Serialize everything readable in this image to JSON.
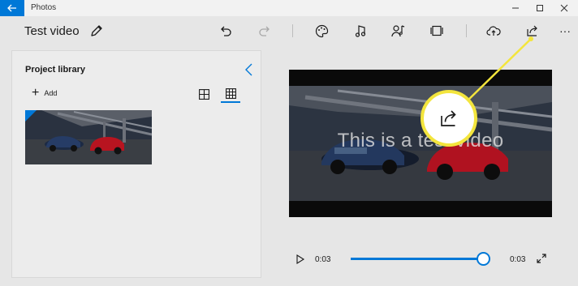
{
  "window": {
    "app_title": "Photos",
    "back_icon": "arrow-left-icon",
    "minimize_icon": "minimize-icon",
    "maximize_icon": "maximize-icon",
    "close_icon": "close-icon"
  },
  "toolbar": {
    "title": "Test video",
    "edit_icon": "pencil-icon",
    "undo_icon": "undo-icon",
    "redo_icon": "redo-icon",
    "themes_icon": "palette-icon",
    "music_icon": "music-note-icon",
    "narration_icon": "custom-audio-icon",
    "aspect_icon": "aspect-ratio-icon",
    "upload_icon": "cloud-upload-icon",
    "share_icon": "share-icon",
    "more_icon": "more-icon",
    "more_label": "···"
  },
  "library": {
    "title": "Project library",
    "add_label": "Add",
    "collapse_icon": "chevron-left-icon",
    "view_large_icon": "grid-large-icon",
    "view_small_icon": "grid-small-icon"
  },
  "preview": {
    "caption": "This is a test video"
  },
  "player": {
    "current_time": "0:03",
    "total_time": "0:03",
    "progress": 1.0,
    "play_icon": "play-icon",
    "expand_icon": "expand-icon"
  },
  "callout": {
    "icon": "share-icon"
  },
  "colors": {
    "accent": "#0078d7",
    "highlight": "#f3e53d"
  }
}
